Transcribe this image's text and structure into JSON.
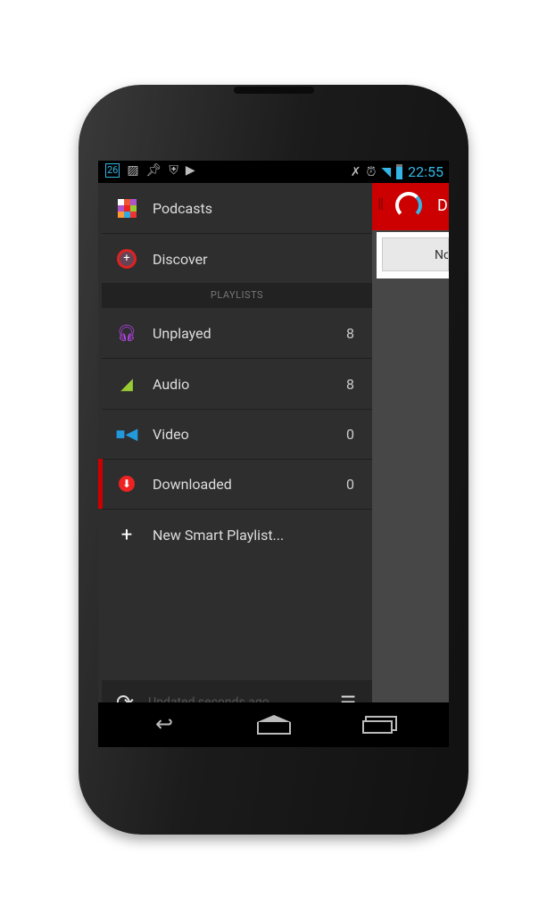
{
  "status_bar": {
    "time": "22:55",
    "left_icons": [
      "calendar-icon",
      "image-icon",
      "pin-icon",
      "shield-icon",
      "play-store-icon"
    ],
    "calendar_day": "26",
    "right_icons": [
      "mute-icon",
      "alarm-icon",
      "wifi-icon",
      "signal-icon",
      "battery-icon"
    ]
  },
  "drawer": {
    "items": [
      {
        "label": "Podcasts",
        "icon": "podcasts-grid-icon"
      },
      {
        "label": "Discover",
        "icon": "discover-magnifier-icon"
      }
    ],
    "section_header": "PLAYLISTS",
    "playlists": [
      {
        "label": "Unplayed",
        "count": "8",
        "icon": "headphones-icon"
      },
      {
        "label": "Audio",
        "count": "8",
        "icon": "audio-icon"
      },
      {
        "label": "Video",
        "count": "0",
        "icon": "video-camera-icon"
      },
      {
        "label": "Downloaded",
        "count": "0",
        "icon": "download-icon",
        "selected": true
      }
    ],
    "new_playlist": "New Smart Playlist...",
    "footer": {
      "status": "Updated seconds ago."
    }
  },
  "main": {
    "title_initial": "D",
    "button_label": "No"
  },
  "colors": {
    "accent": "#cc0000",
    "status_blue": "#33b5e5",
    "drawer_bg": "#2e2e2e"
  }
}
